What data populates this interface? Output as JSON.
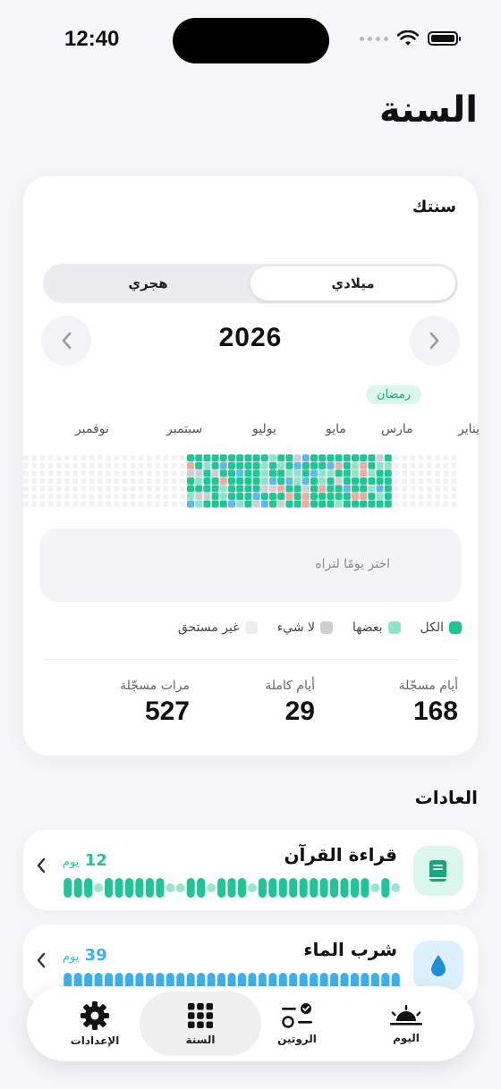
{
  "status": {
    "time": "12:40"
  },
  "page": {
    "title": "السنة"
  },
  "year_card": {
    "title": "سنتك",
    "segments": [
      "ميلادي",
      "هجري"
    ],
    "active_segment": "ميلادي",
    "year": "2026",
    "ramadan_label": "رمضان",
    "months": [
      "يناير",
      "مارس",
      "مايو",
      "يوليو",
      "سبتمبر",
      "نوفمبر"
    ],
    "day_prompt": "اختر يومًا لتراه",
    "legend": [
      {
        "label": "الكل",
        "color": "#1fc592"
      },
      {
        "label": "بعضها",
        "color": "#8fe3c6"
      },
      {
        "label": "لا شيء",
        "color": "#cfcfd3"
      },
      {
        "label": "غير مستحق",
        "color": "#ededf0"
      }
    ],
    "stats": [
      {
        "label": "أيام مسجّلة",
        "value": "168"
      },
      {
        "label": "أيام كاملة",
        "value": "29"
      },
      {
        "label": "مرات مسجّلة",
        "value": "527"
      }
    ]
  },
  "habits_section": {
    "title": "العادات",
    "habits": [
      {
        "name": "قراءة القرآن",
        "count": "12",
        "unit": "يوم",
        "accent": "#1fc592",
        "icon_bg": "#dbf6ec",
        "icon": "book-icon"
      },
      {
        "name": "شرب الماء",
        "count": "39",
        "unit": "يوم",
        "accent": "#3db1ee",
        "icon_bg": "#ddf1fc",
        "icon": "water-drop-icon"
      }
    ]
  },
  "tabbar": {
    "tabs": [
      {
        "label": "اليوم",
        "icon": "sunrise-icon"
      },
      {
        "label": "الروتين",
        "icon": "routine-icon"
      },
      {
        "label": "السنة",
        "icon": "grid-icon"
      },
      {
        "label": "الإعدادات",
        "icon": "gear-icon"
      }
    ],
    "active_tab": "السنة"
  }
}
